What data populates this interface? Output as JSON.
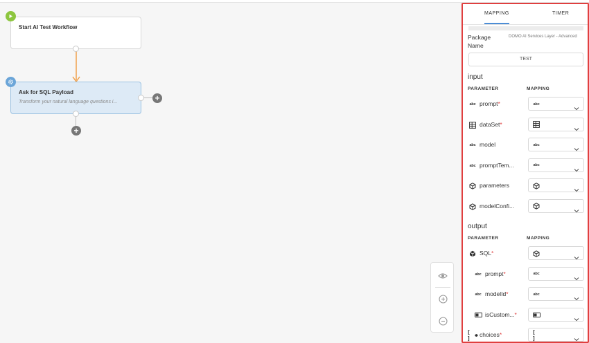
{
  "canvas": {
    "start_node": {
      "title": "Start AI Test Workflow"
    },
    "ask_node": {
      "title": "Ask for SQL Payload",
      "subtitle": "Transform your natural language questions i..."
    }
  },
  "panel": {
    "tabs": [
      "MAPPING",
      "TIMER"
    ],
    "active_tab": "MAPPING",
    "package_label": "Package Name",
    "package_value": "DOMO AI Services Layer - Advanced",
    "test_button": "TEST",
    "input": {
      "title": "input",
      "param_header": "PARAMETER",
      "mapping_header": "MAPPING",
      "rows": [
        {
          "name": "prompt",
          "required": "*",
          "icon": "abc-icon",
          "map_icon": "abc-icon"
        },
        {
          "name": "dataSet",
          "required": "*",
          "icon": "table-icon",
          "map_icon": "table-icon"
        },
        {
          "name": "model",
          "required": "",
          "icon": "abc-icon",
          "map_icon": "abc-icon"
        },
        {
          "name": "promptTem...",
          "required": "",
          "icon": "abc-icon",
          "map_icon": "abc-icon"
        },
        {
          "name": "parameters",
          "required": "",
          "icon": "cube-icon",
          "map_icon": "cube-icon"
        },
        {
          "name": "modelConfi...",
          "required": "",
          "icon": "cube-icon",
          "map_icon": "cube-icon"
        }
      ]
    },
    "output": {
      "title": "output",
      "param_header": "PARAMETER",
      "mapping_header": "MAPPING",
      "rows": [
        {
          "name": "SQL",
          "required": "*",
          "icon": "cube-filled-icon",
          "map_icon": "cube-icon"
        },
        {
          "name": "prompt",
          "required": "*",
          "icon": "abc-icon",
          "map_icon": "abc-icon"
        },
        {
          "name": "modelId",
          "required": "*",
          "icon": "abc-icon",
          "map_icon": "abc-icon"
        },
        {
          "name": "isCustom...",
          "required": "*",
          "icon": "toggle-icon",
          "map_icon": "toggle-icon"
        },
        {
          "name": "choices",
          "required": "*",
          "icon": "array-cube-icon",
          "map_icon": "array-icon"
        }
      ]
    },
    "abc_glyph": "abc",
    "array_glyph": "[ ]"
  },
  "colors": {
    "accent_blue": "#4c8dd6",
    "start_badge": "#8dc63f",
    "gear_badge": "#6ba5d8",
    "connector": "#f0a04b",
    "panel_border": "#e03f3f",
    "required": "#e03f3f"
  }
}
